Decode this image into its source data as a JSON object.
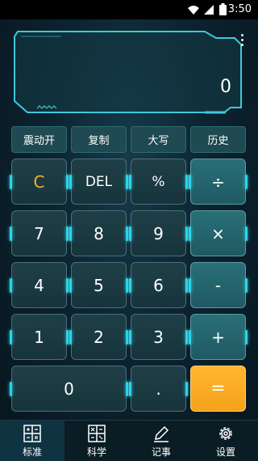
{
  "status": {
    "time": "3:50",
    "icons": [
      "wifi-icon",
      "signal-icon",
      "battery-icon"
    ]
  },
  "display": {
    "value": "0"
  },
  "top_buttons": [
    "震动开",
    "复制",
    "大写",
    "历史"
  ],
  "keys": {
    "c": "C",
    "del": "DEL",
    "percent": "%",
    "divide": "÷",
    "seven": "7",
    "eight": "8",
    "nine": "9",
    "multiply": "×",
    "four": "4",
    "five": "5",
    "six": "6",
    "minus": "-",
    "one": "1",
    "two": "2",
    "three": "3",
    "plus": "+",
    "zero": "0",
    "dot": ".",
    "equals": "="
  },
  "tabs": [
    "标准",
    "科学",
    "记事",
    "设置"
  ],
  "colors": {
    "accent": "#2fd3e6",
    "equals": "#ffb62e",
    "clear": "#f5b324"
  }
}
